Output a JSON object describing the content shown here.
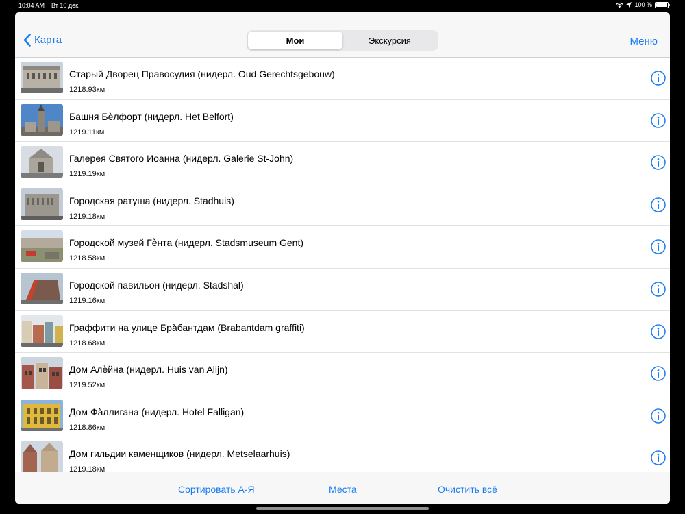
{
  "status_bar": {
    "time": "10:04 AM",
    "date": "Вт 10 дек.",
    "battery": "100 %",
    "icons": [
      "wifi-icon",
      "location-arrow-icon",
      "battery-icon"
    ]
  },
  "nav": {
    "back_label": "Карта",
    "segments": [
      {
        "label": "Мои",
        "selected": true
      },
      {
        "label": "Экскурсия",
        "selected": false
      }
    ],
    "menu_label": "Меню"
  },
  "places": [
    {
      "title": "Старый Дворец Правосудия (нидерл. Oud Gerechtsgebouw)",
      "distance": "1218.93км",
      "thumb": "building-grey"
    },
    {
      "title": "Башня Бѐлфорт (нидерл. Het Belfort)",
      "distance": "1219.11км",
      "thumb": "tower-blue-sky"
    },
    {
      "title": "Галерея Святого Иоанна (нидерл. Galerie St-John)",
      "distance": "1219.19км",
      "thumb": "church-grey"
    },
    {
      "title": "Городская ратуша (нидерл. Stadhuis)",
      "distance": "1219.18км",
      "thumb": "gothic-grey"
    },
    {
      "title": "Городской музей Гѐнта (нидерл. Stadsmuseum Gent)",
      "distance": "1218.58км",
      "thumb": "courtyard-red"
    },
    {
      "title": "Городской павильон (нидерл. Stadshal)",
      "distance": "1219.16км",
      "thumb": "pavilion-red"
    },
    {
      "title": "Граффити на улице Бра̀бантдам (Brabantdam graffiti)",
      "distance": "1218.68км",
      "thumb": "street-colorful"
    },
    {
      "title": "Дом Алѐйна (нидерл. Huis van Alijn)",
      "distance": "1219.52км",
      "thumb": "brick-houses"
    },
    {
      "title": "Дом Фа̀ллигана (нидерл. Hotel Falligan)",
      "distance": "1218.86км",
      "thumb": "yellow-facade"
    },
    {
      "title": "Дом гильдии каменщиков (нидерл. Metselaarhuis)",
      "distance": "1219.18км",
      "thumb": "gable-house"
    }
  ],
  "toolbar": {
    "sort_label": "Сортировать А-Я",
    "places_label": "Места",
    "clear_label": "Очистить всё"
  },
  "colors": {
    "accent": "#1a7cf2",
    "bar_bg": "#f7f7f7"
  }
}
